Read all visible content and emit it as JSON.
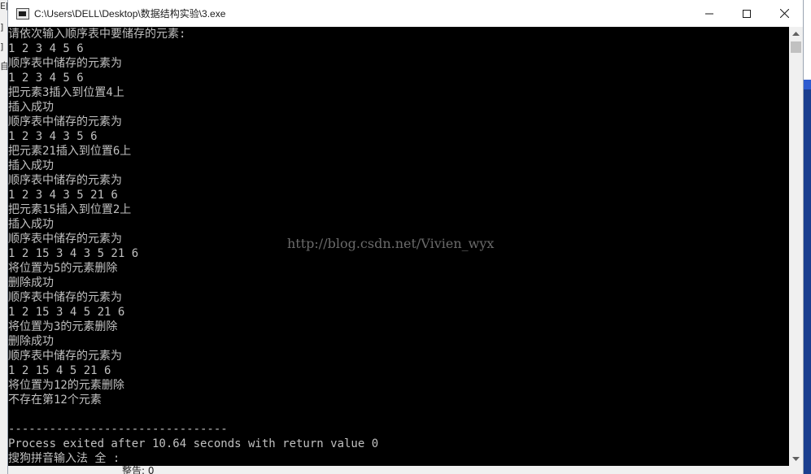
{
  "window": {
    "title": "C:\\Users\\DELL\\Desktop\\数据结构实验\\3.exe"
  },
  "background": {
    "left_chars": [
      "E[",
      "]",
      "]",
      "自"
    ],
    "bottom_text": "整告: 0"
  },
  "console": {
    "lines": [
      "请依次输入顺序表中要储存的元素:",
      "1 2 3 4 5 6",
      "顺序表中储存的元素为",
      "1 2 3 4 5 6",
      "把元素3插入到位置4上",
      "插入成功",
      "顺序表中储存的元素为",
      "1 2 3 4 3 5 6",
      "把元素21插入到位置6上",
      "插入成功",
      "顺序表中储存的元素为",
      "1 2 3 4 3 5 21 6",
      "把元素15插入到位置2上",
      "插入成功",
      "顺序表中储存的元素为",
      "1 2 15 3 4 3 5 21 6",
      "将位置为5的元素删除",
      "删除成功",
      "顺序表中储存的元素为",
      "1 2 15 3 4 5 21 6",
      "将位置为3的元素删除",
      "删除成功",
      "顺序表中储存的元素为",
      "1 2 15 4 5 21 6",
      "将位置为12的元素删除",
      "不存在第12个元素",
      "",
      "--------------------------------",
      "Process exited after 10.64 seconds with return value 0",
      "搜狗拼音输入法 全 :"
    ],
    "watermark": "http://blog.csdn.net/Vivien_wyx"
  },
  "colors": {
    "console_bg": "#000000",
    "console_text": "#c0c0c0",
    "watermark": "#6a6a6a"
  }
}
